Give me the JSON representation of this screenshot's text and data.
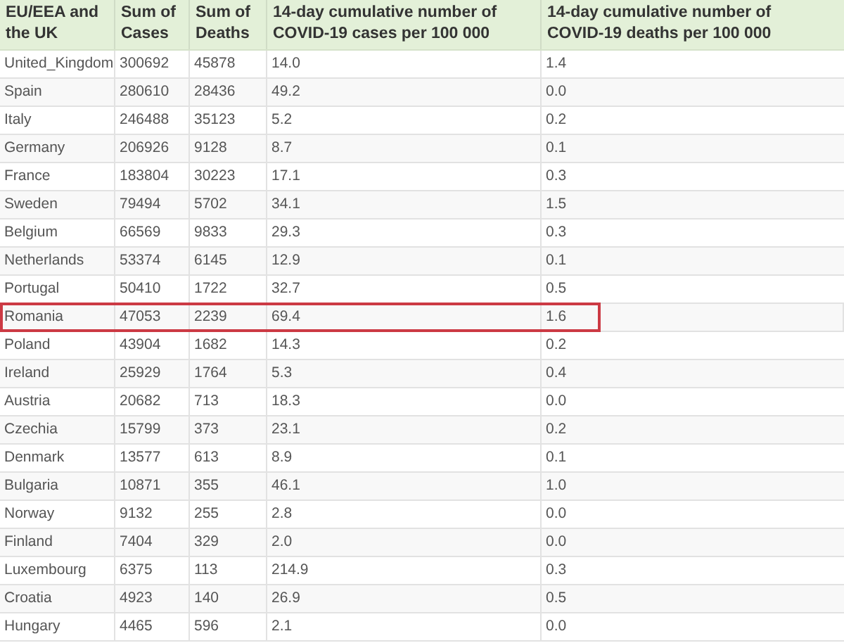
{
  "table": {
    "columns": [
      "EU/EEA and the UK",
      "Sum of Cases",
      "Sum of Deaths",
      "14-day cumulative number of COVID-19 cases per 100 000",
      "14-day cumulative number of COVID-19 deaths per 100 000"
    ],
    "rows": [
      {
        "cells": [
          "United_Kingdom",
          "300692",
          "45878",
          "14.0",
          "1.4"
        ],
        "highlighted": false
      },
      {
        "cells": [
          "Spain",
          "280610",
          "28436",
          "49.2",
          "0.0"
        ],
        "highlighted": false
      },
      {
        "cells": [
          "Italy",
          "246488",
          "35123",
          "5.2",
          "0.2"
        ],
        "highlighted": false
      },
      {
        "cells": [
          "Germany",
          "206926",
          "9128",
          "8.7",
          "0.1"
        ],
        "highlighted": false
      },
      {
        "cells": [
          "France",
          "183804",
          "30223",
          "17.1",
          "0.3"
        ],
        "highlighted": false
      },
      {
        "cells": [
          "Sweden",
          "79494",
          "5702",
          "34.1",
          "1.5"
        ],
        "highlighted": false
      },
      {
        "cells": [
          "Belgium",
          "66569",
          "9833",
          "29.3",
          "0.3"
        ],
        "highlighted": false
      },
      {
        "cells": [
          "Netherlands",
          "53374",
          "6145",
          "12.9",
          "0.1"
        ],
        "highlighted": false
      },
      {
        "cells": [
          "Portugal",
          "50410",
          "1722",
          "32.7",
          "0.5"
        ],
        "highlighted": false
      },
      {
        "cells": [
          "Romania",
          "47053",
          "2239",
          "69.4",
          "1.6"
        ],
        "highlighted": true
      },
      {
        "cells": [
          "Poland",
          "43904",
          "1682",
          "14.3",
          "0.2"
        ],
        "highlighted": false
      },
      {
        "cells": [
          "Ireland",
          "25929",
          "1764",
          "5.3",
          "0.4"
        ],
        "highlighted": false
      },
      {
        "cells": [
          "Austria",
          "20682",
          "713",
          "18.3",
          "0.0"
        ],
        "highlighted": false
      },
      {
        "cells": [
          "Czechia",
          "15799",
          "373",
          "23.1",
          "0.2"
        ],
        "highlighted": false
      },
      {
        "cells": [
          "Denmark",
          "13577",
          "613",
          "8.9",
          "0.1"
        ],
        "highlighted": false
      },
      {
        "cells": [
          "Bulgaria",
          "10871",
          "355",
          "46.1",
          "1.0"
        ],
        "highlighted": false
      },
      {
        "cells": [
          "Norway",
          "9132",
          "255",
          "2.8",
          "0.0"
        ],
        "highlighted": false
      },
      {
        "cells": [
          "Finland",
          "7404",
          "329",
          "2.0",
          "0.0"
        ],
        "highlighted": false
      },
      {
        "cells": [
          "Luxembourg",
          "6375",
          "113",
          "214.9",
          "0.3"
        ],
        "highlighted": false
      },
      {
        "cells": [
          "Croatia",
          "4923",
          "140",
          "26.9",
          "0.5"
        ],
        "highlighted": false
      },
      {
        "cells": [
          "Hungary",
          "4465",
          "596",
          "2.1",
          "0.0"
        ],
        "highlighted": false
      }
    ]
  }
}
